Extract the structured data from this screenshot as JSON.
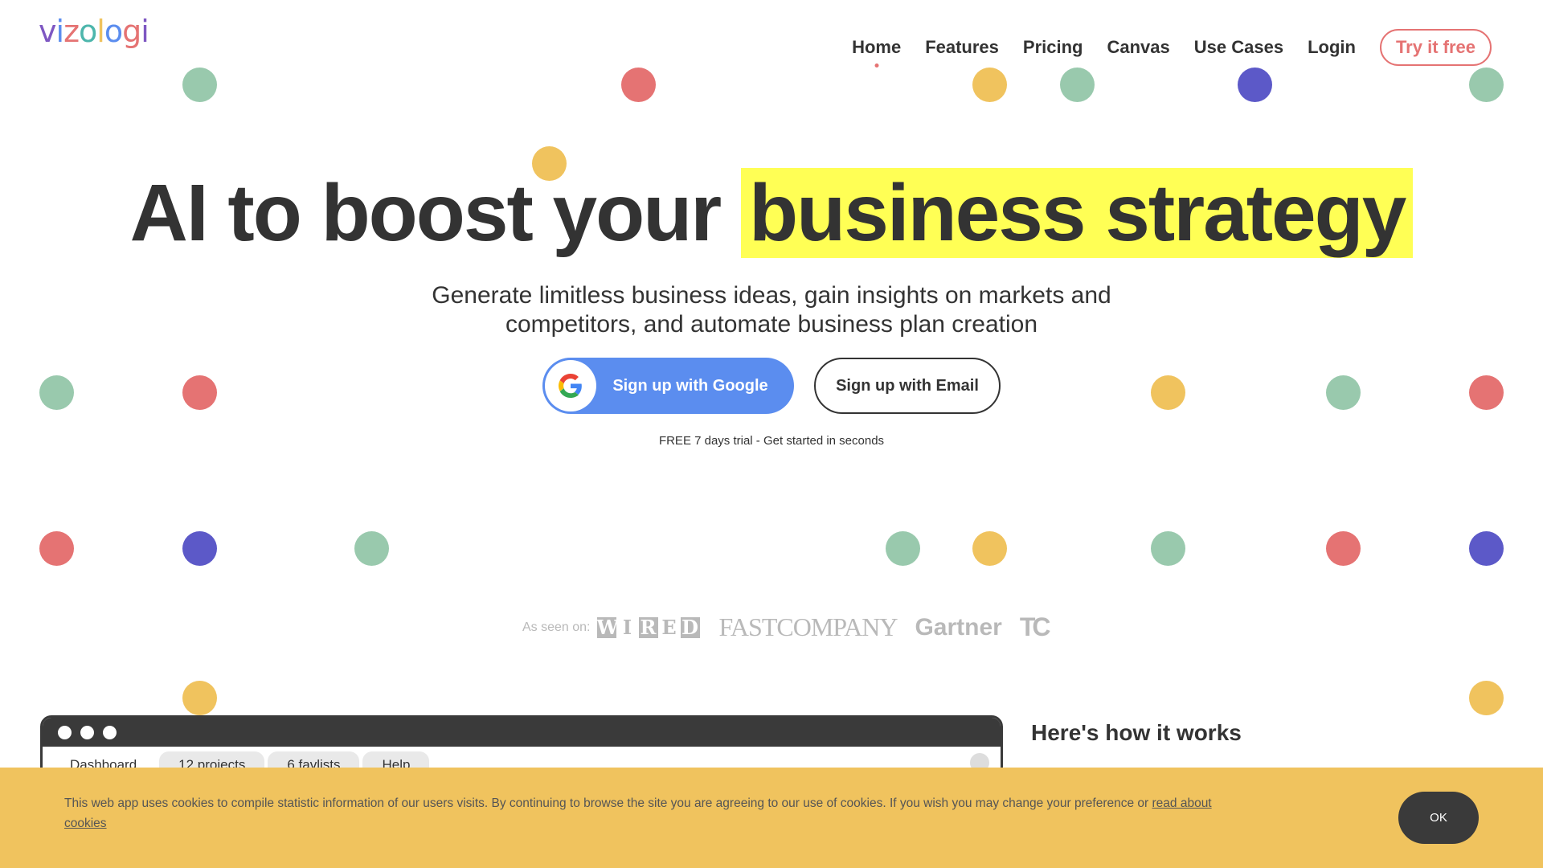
{
  "header": {
    "logo_text": "vizologi",
    "logo_colors": [
      "#7e57c2",
      "#5b8def",
      "#e57373",
      "#4db6ac",
      "#f0c35e",
      "#5b8def",
      "#e57373",
      "#7e57c2"
    ],
    "nav": [
      {
        "label": "Home",
        "active": true
      },
      {
        "label": "Features"
      },
      {
        "label": "Pricing"
      },
      {
        "label": "Canvas"
      },
      {
        "label": "Use Cases"
      },
      {
        "label": "Login"
      }
    ],
    "cta_label": "Try it free"
  },
  "hero": {
    "title_part1": "AI to boost your",
    "title_highlight": "business strategy",
    "subtitle": "Generate limitless business ideas, gain insights on markets and competitors, and automate business plan creation",
    "google_button": "Sign up with Google",
    "email_button": "Sign up with Email",
    "trial_note": "FREE 7 days trial - Get started in seconds"
  },
  "press": {
    "label": "As seen on:",
    "wired": "WIRED",
    "fastcompany": "FASTCOMPANY",
    "gartner": "Gartner",
    "techcrunch": "TC"
  },
  "mockup": {
    "tabs": [
      "Dashboard",
      "12 projects",
      "6 favlists",
      "Help"
    ]
  },
  "how_it_works": "Here's how it works",
  "cookie": {
    "text": "This web app uses cookies to compile statistic information of our users visits. By continuing to browse the site you are agreeing to our use of cookies. If you wish you may change your preference or ",
    "link_text": "read about cookies",
    "ok_label": "OK"
  },
  "colors": {
    "green": "#99c9ad",
    "red": "#e57373",
    "yellow": "#f0c35e",
    "purple": "#5c59c8",
    "google_blue": "#5b8def",
    "highlight": "#ffff55"
  }
}
